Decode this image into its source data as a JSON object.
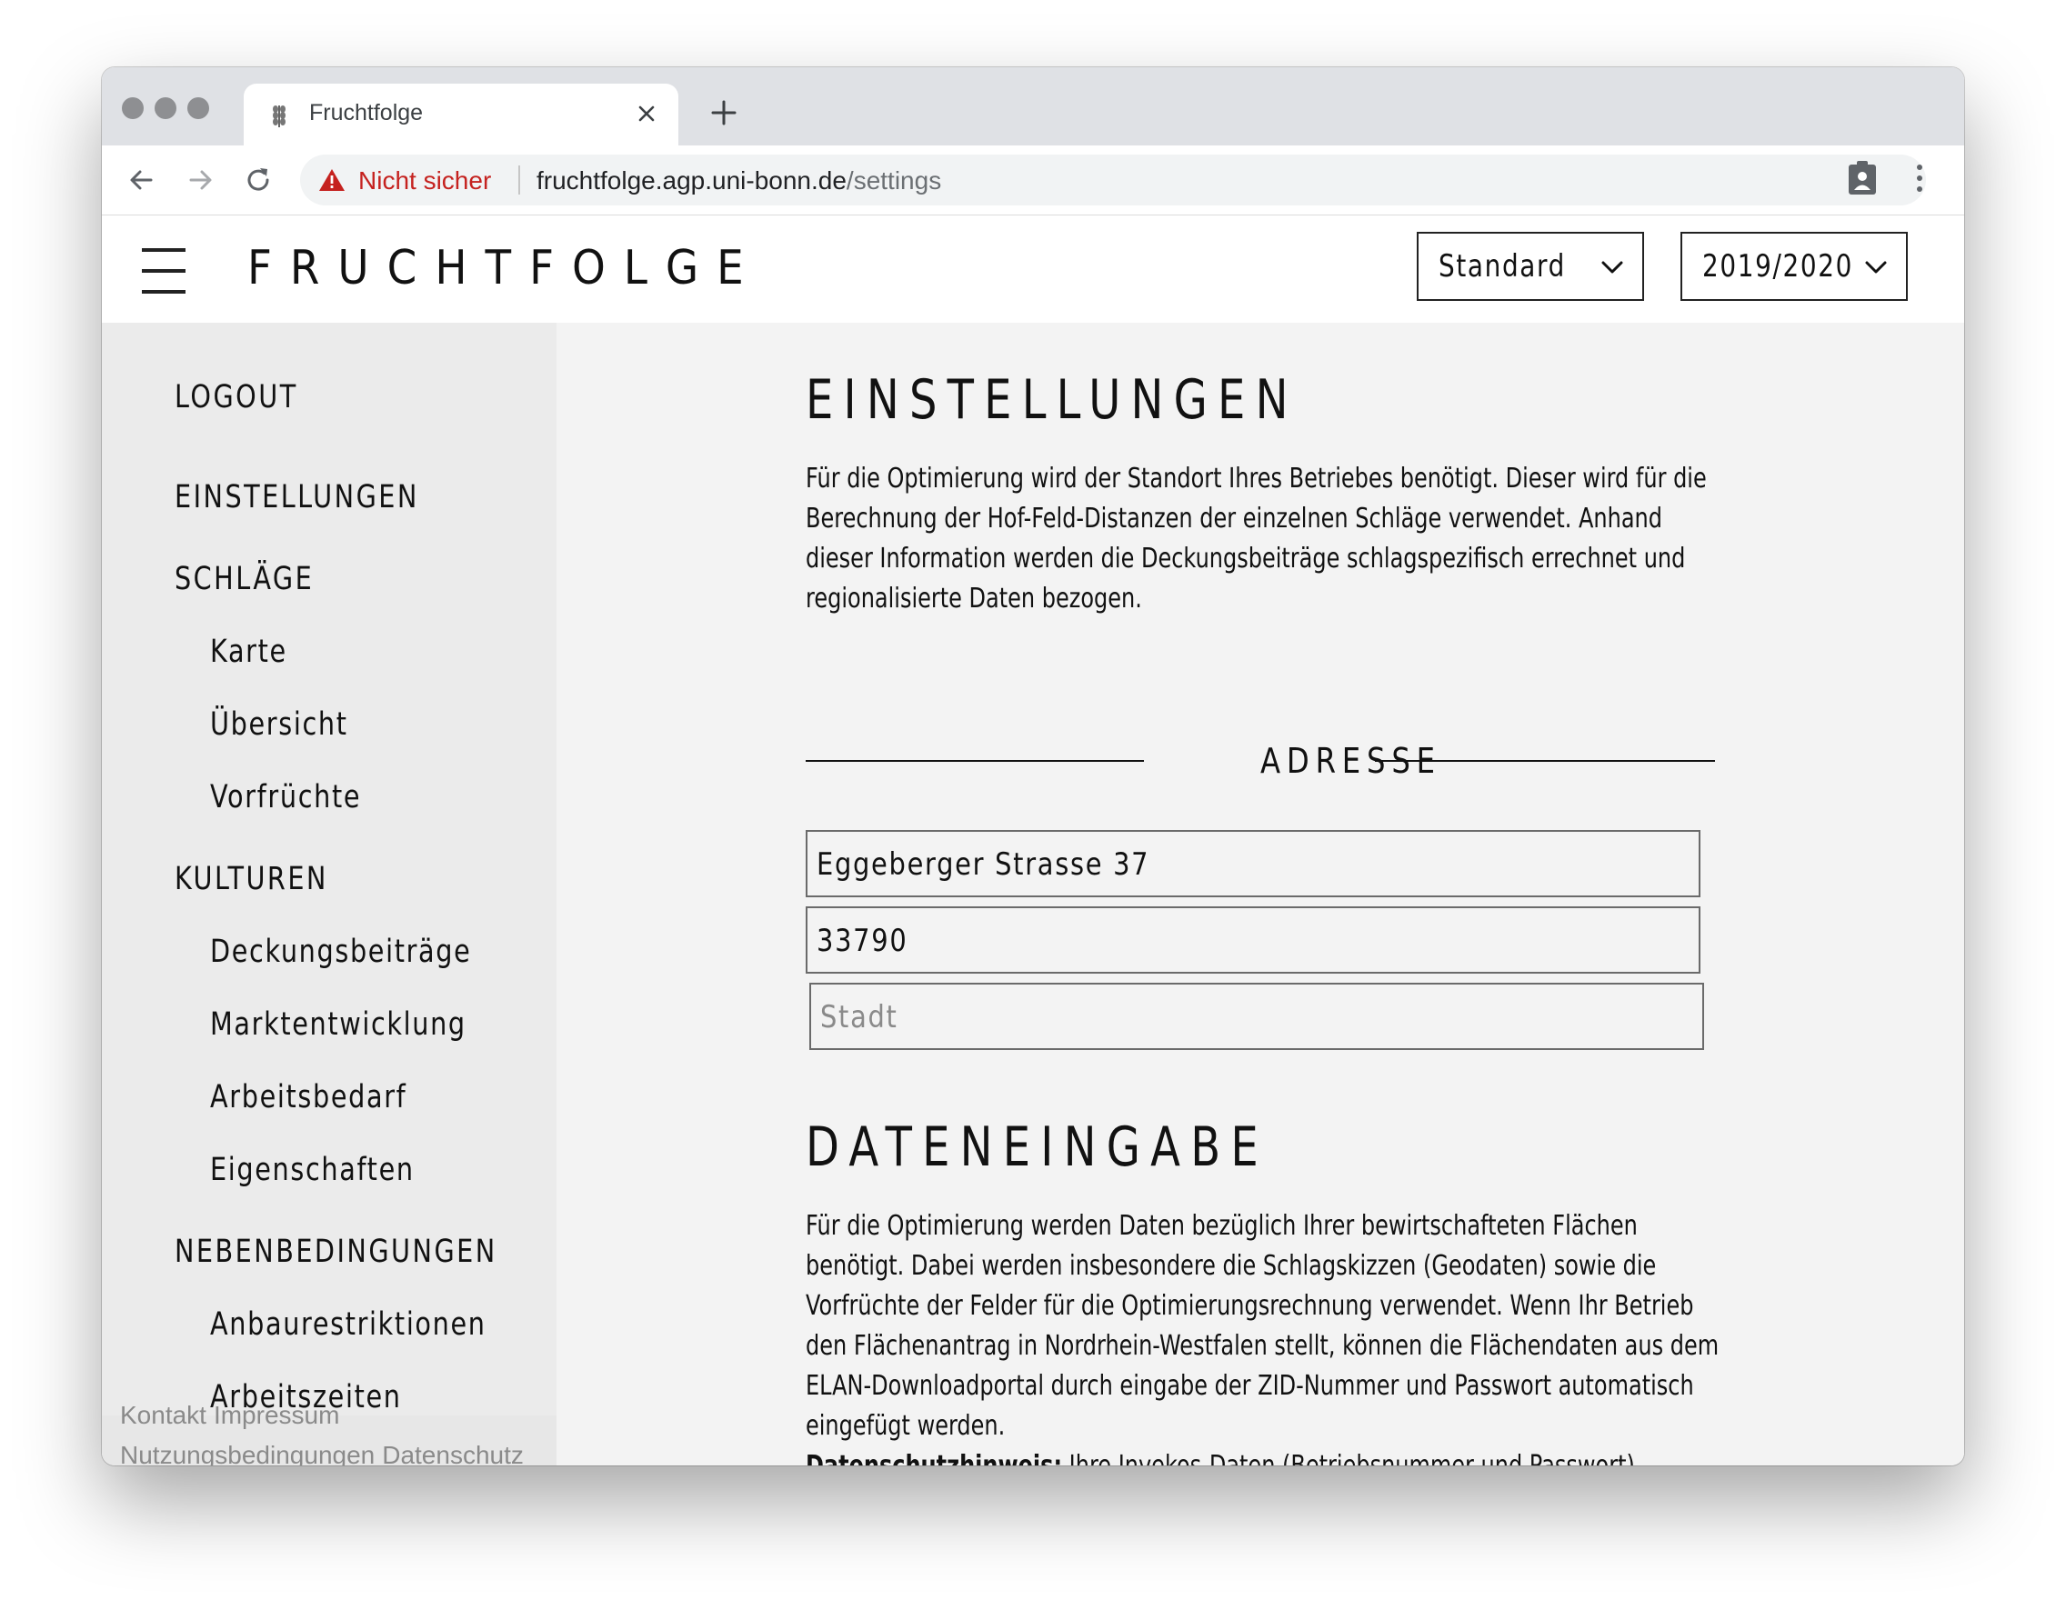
{
  "browser": {
    "tab_title": "Fruchtfolge",
    "security_label": "Nicht sicher",
    "url_host": "fruchtfolge.agp.uni-bonn.de",
    "url_path": "/settings"
  },
  "header": {
    "brand": "FRUCHTFOLGE",
    "mode_select": "Standard",
    "year_select": "2019/2020"
  },
  "sidebar": {
    "logout": "LOGOUT",
    "einstellungen": "EINSTELLUNGEN",
    "schlaege": "SCHLÄGE",
    "karte": "Karte",
    "uebersicht": "Übersicht",
    "vorfruechte": "Vorfrüchte",
    "kulturen": "KULTUREN",
    "deckungsbeitraege": "Deckungsbeiträge",
    "marktentwicklung": "Marktentwicklung",
    "arbeitsbedarf": "Arbeitsbedarf",
    "eigenschaften": "Eigenschaften",
    "nebenbedingungen": "NEBENBEDINGUNGEN",
    "anbaurestriktionen": "Anbaurestriktionen",
    "arbeitszeiten": "Arbeitszeiten"
  },
  "footer": {
    "kontakt": "Kontakt",
    "impressum": "Impressum",
    "nutzungsbedingungen": "Nutzungsbedingungen",
    "datenschutz": "Datenschutz"
  },
  "main": {
    "settings_title": "EINSTELLUNGEN",
    "settings_text": "Für die Optimierung wird der Standort Ihres Betriebes benötigt. Dieser wird für die Berechnung der Hof-Feld-Distanzen der einzelnen Schläge verwendet. Anhand dieser Information werden die Deckungsbeiträge schlagspezifisch errechnet und regionalisierte Daten bezogen.",
    "address_label": "ADRESSE",
    "street_value": "Eggeberger Strasse 37",
    "zip_value": "33790",
    "city_placeholder": "Stadt",
    "data_title": "DATENEINGABE",
    "data_text": "Für die Optimierung werden Daten bezüglich Ihrer bewirtschafteten Flächen benötigt. Dabei werden insbesondere die Schlagskizzen (Geodaten) sowie die Vorfrüchte der Felder für die Optimierungsrechnung verwendet. Wenn Ihr Betrieb den Flächenantrag in Nordrhein-Westfalen stellt, können die Flächendaten aus dem ELAN-Downloadportal durch eingabe der ZID-Nummer und Passwort automatisch eingefügt werden.",
    "privacy_label": "Datenschutzhinweis:",
    "privacy_text": " Ihre Invekos-Daten (Betriebsnummer und Passwort) werden einmalig zur"
  },
  "colors": {
    "security_red": "#c5221f",
    "sidebar_bg": "#ebebeb",
    "main_bg": "#f3f3f3"
  }
}
